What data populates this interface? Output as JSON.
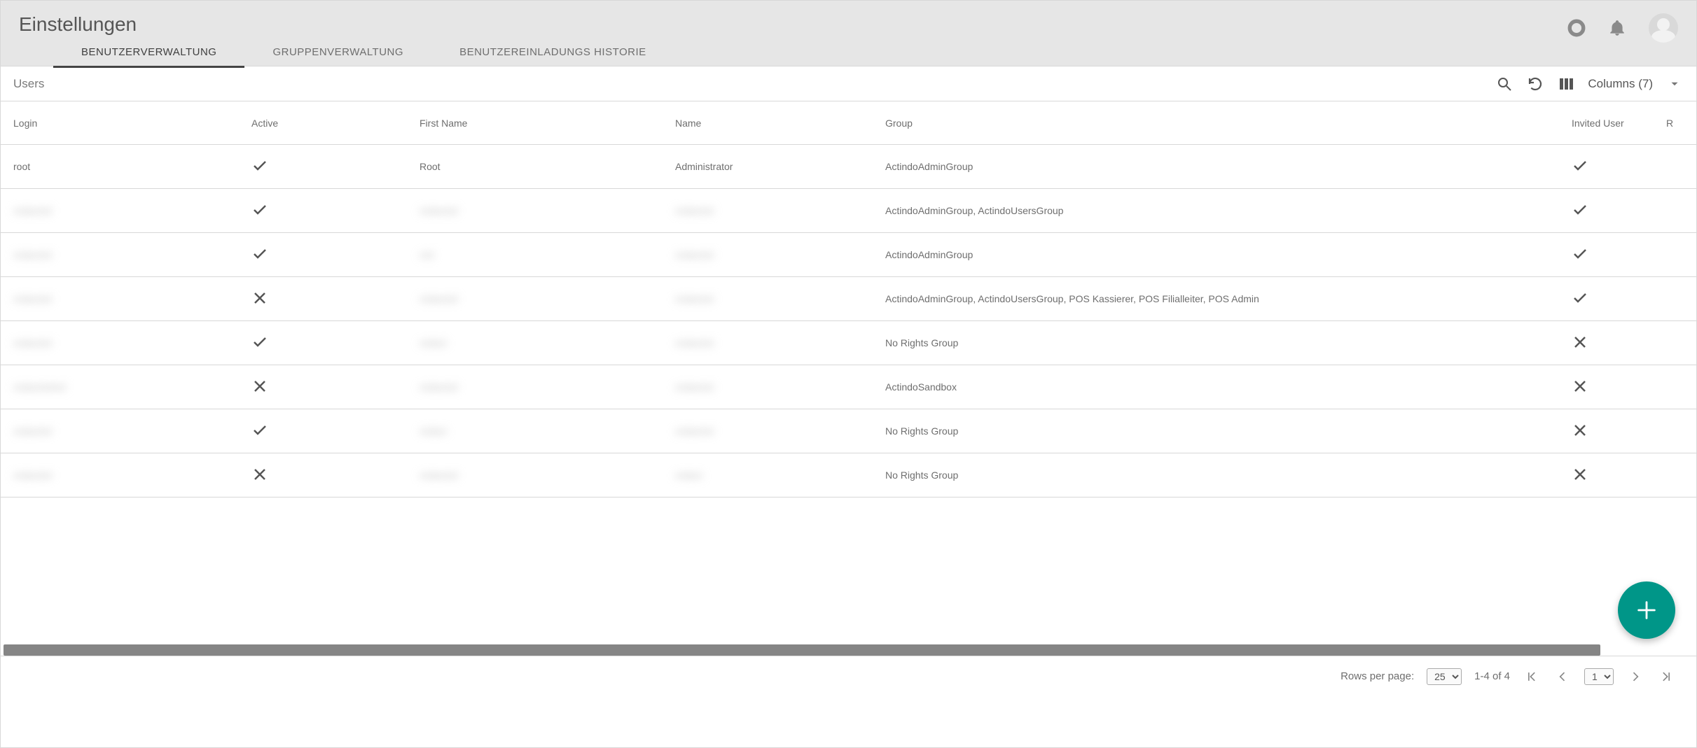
{
  "header": {
    "title": "Einstellungen"
  },
  "tabs": {
    "items": [
      {
        "id": "users",
        "label": "BENUTZERVERWALTUNG",
        "active": true
      },
      {
        "id": "groups",
        "label": "GRUPPENVERWALTUNG",
        "active": false
      },
      {
        "id": "invites",
        "label": "BENUTZEREINLADUNGS HISTORIE",
        "active": false
      }
    ]
  },
  "toolbar": {
    "section_title": "Users",
    "columns_label": "Columns (7)"
  },
  "table": {
    "columns": {
      "login": "Login",
      "active": "Active",
      "fname": "First Name",
      "name": "Name",
      "group": "Group",
      "invited": "Invited User",
      "tail": "R"
    },
    "rows": [
      {
        "login": "root",
        "login_blur": false,
        "active": true,
        "fname": "Root",
        "fname_blur": false,
        "name": "Administrator",
        "name_blur": false,
        "group": "ActindoAdminGroup",
        "invited": true
      },
      {
        "login": "redacted",
        "login_blur": true,
        "active": true,
        "fname": "redacted",
        "fname_blur": true,
        "name": "redacted",
        "name_blur": true,
        "group": "ActindoAdminGroup, ActindoUsersGroup",
        "invited": true
      },
      {
        "login": "redacted",
        "login_blur": true,
        "active": true,
        "fname": "red",
        "fname_blur": true,
        "name": "redacted",
        "name_blur": true,
        "group": "ActindoAdminGroup",
        "invited": true
      },
      {
        "login": "redacted",
        "login_blur": true,
        "active": false,
        "fname": "redacted",
        "fname_blur": true,
        "name": "redacted",
        "name_blur": true,
        "group": "ActindoAdminGroup, ActindoUsersGroup, POS Kassierer, POS Filialleiter, POS Admin",
        "invited": true
      },
      {
        "login": "redacted",
        "login_blur": true,
        "active": true,
        "fname": "redact",
        "fname_blur": true,
        "name": "redacted",
        "name_blur": true,
        "group": "No Rights Group",
        "invited": false
      },
      {
        "login": "redactedred",
        "login_blur": true,
        "active": false,
        "fname": "redacted",
        "fname_blur": true,
        "name": "redacted",
        "name_blur": true,
        "group": "ActindoSandbox",
        "invited": false
      },
      {
        "login": "redacted",
        "login_blur": true,
        "active": true,
        "fname": "redact",
        "fname_blur": true,
        "name": "redacted",
        "name_blur": true,
        "group": "No Rights Group",
        "invited": false
      },
      {
        "login": "redacted",
        "login_blur": true,
        "active": false,
        "fname": "redacted",
        "fname_blur": true,
        "name": "redact",
        "name_blur": true,
        "group": "No Rights Group",
        "invited": false
      }
    ],
    "cutoff_row": {
      "login": "",
      "fname": "",
      "name": ""
    }
  },
  "pagination": {
    "rows_per_page_label": "Rows per page:",
    "rows_per_page_value": "25",
    "range_display": "1-4 of 4",
    "page_value": "1"
  }
}
